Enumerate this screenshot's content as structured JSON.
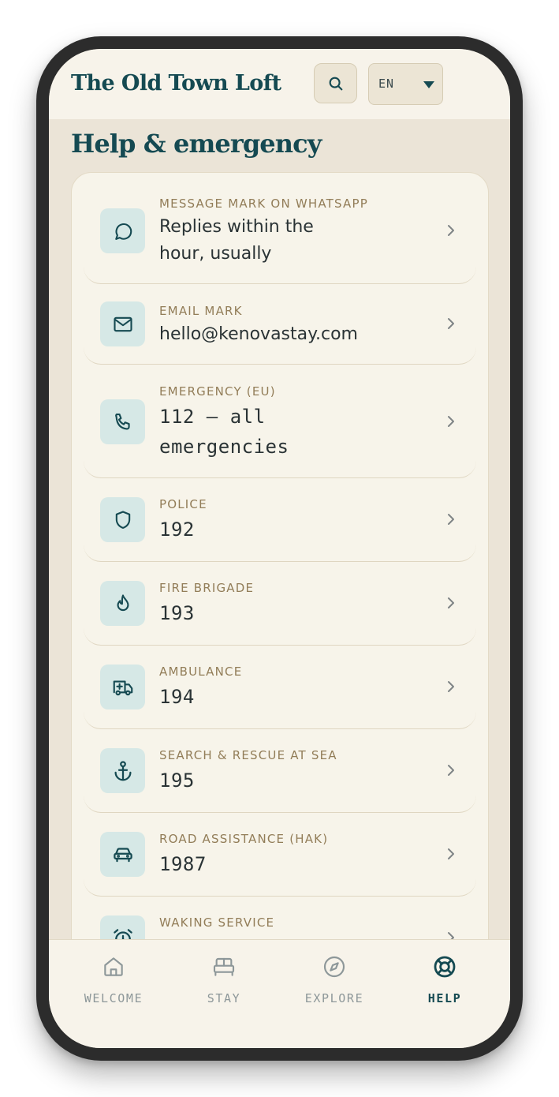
{
  "app": {
    "title": "The Old Town Loft",
    "language": "EN"
  },
  "colors": {
    "brand": "#154a52",
    "label": "#927d58",
    "icon_tile": "#d6e8e6",
    "card_bg": "#f7f4ea",
    "page_bg": "#ebe4d7"
  },
  "page": {
    "title": "Help & emergency"
  },
  "contacts": [
    {
      "icon": "message-circle-icon",
      "label": "MESSAGE MARK ON WHATSAPP",
      "lines": [
        "Replies within the",
        "hour, usually"
      ]
    },
    {
      "icon": "mail-icon",
      "label": "EMAIL MARK",
      "lines": [
        "hello@kenovastay.com"
      ]
    },
    {
      "icon": "phone-icon",
      "label": "EMERGENCY (EU)",
      "lines": [
        "112 — all",
        "emergencies"
      ]
    },
    {
      "icon": "shield-icon",
      "label": "POLICE",
      "lines": [
        "192"
      ]
    },
    {
      "icon": "flame-icon",
      "label": "FIRE BRIGADE",
      "lines": [
        "193"
      ]
    },
    {
      "icon": "ambulance-icon",
      "label": "AMBULANCE",
      "lines": [
        "194"
      ]
    },
    {
      "icon": "anchor-icon",
      "label": "SEARCH & RESCUE AT SEA",
      "lines": [
        "195"
      ]
    },
    {
      "icon": "car-icon",
      "label": "ROAD ASSISTANCE (HAK)",
      "lines": [
        "1987"
      ]
    },
    {
      "icon": "alarm-clock-icon",
      "label": "WAKING SERVICE",
      "lines": []
    }
  ],
  "tabs": [
    {
      "label": "WELCOME",
      "icon": "home-icon",
      "active": false
    },
    {
      "label": "STAY",
      "icon": "bed-icon",
      "active": false
    },
    {
      "label": "EXPLORE",
      "icon": "compass-icon",
      "active": false
    },
    {
      "label": "HELP",
      "icon": "lifebuoy-icon",
      "active": true
    }
  ]
}
